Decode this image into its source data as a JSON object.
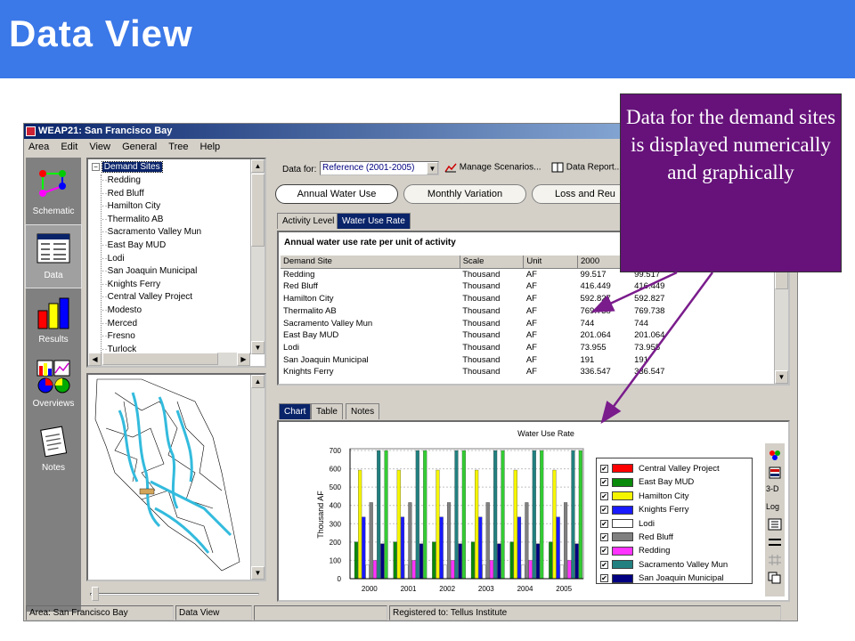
{
  "slide": {
    "title": "Data View",
    "callout": "Data for the demand sites is displayed numerically and graphically",
    "colors": {
      "banner": "#3b78e8",
      "callout": "#66127a",
      "arrow": "#7a1c8c"
    }
  },
  "window": {
    "title": "WEAP21: San Francisco Bay",
    "menu": [
      "Area",
      "Edit",
      "View",
      "General",
      "Tree",
      "Help"
    ]
  },
  "sidebar": [
    {
      "label": "Schematic",
      "icon": "schematic-icon"
    },
    {
      "label": "Data",
      "icon": "data-icon"
    },
    {
      "label": "Results",
      "icon": "results-icon"
    },
    {
      "label": "Overviews",
      "icon": "overviews-icon"
    },
    {
      "label": "Notes",
      "icon": "notes-icon"
    }
  ],
  "tree": {
    "root": "Demand Sites",
    "items": [
      "Redding",
      "Red Bluff",
      "Hamilton City",
      "Thermalito AB",
      "Sacramento Valley Mun",
      "East Bay MUD",
      "Lodi",
      "San Joaquin Municipal",
      "Knights Ferry",
      "Central Valley Project",
      "Modesto",
      "Merced",
      "Fresno",
      "Turlock"
    ]
  },
  "toolbar": {
    "data_for_label": "Data for:",
    "data_for_value": "Reference (2001-2005)",
    "manage_scenarios": "Manage Scenarios...",
    "data_report": "Data Report..."
  },
  "view_tabs": [
    "Annual Water Use",
    "Monthly Variation",
    "Loss and Reu"
  ],
  "sub_tabs": [
    "Activity Level",
    "Water Use Rate"
  ],
  "grid": {
    "caption": "Annual water use rate per unit of activity",
    "columns": [
      "Demand Site",
      "Scale",
      "Unit",
      "2000",
      "2001-2005"
    ],
    "rows": [
      [
        "Redding",
        "Thousand",
        "AF",
        "99.517",
        "99.517"
      ],
      [
        "Red Bluff",
        "Thousand",
        "AF",
        "416.449",
        "416.449"
      ],
      [
        "Hamilton City",
        "Thousand",
        "AF",
        "592.827",
        "592.827"
      ],
      [
        "Thermalito AB",
        "Thousand",
        "AF",
        "769.738",
        "769.738"
      ],
      [
        "Sacramento Valley Mun",
        "Thousand",
        "AF",
        "744",
        "744"
      ],
      [
        "East Bay MUD",
        "Thousand",
        "AF",
        "201.064",
        "201.064"
      ],
      [
        "Lodi",
        "Thousand",
        "AF",
        "73.955",
        "73.955"
      ],
      [
        "San Joaquin Municipal",
        "Thousand",
        "AF",
        "191",
        "191"
      ],
      [
        "Knights Ferry",
        "Thousand",
        "AF",
        "336.547",
        "336.547"
      ]
    ]
  },
  "bottom_tabs": [
    "Chart",
    "Table",
    "Notes"
  ],
  "chart_tools": {
    "three_d": "3-D",
    "log": "Log"
  },
  "chart_data": {
    "type": "bar",
    "title": "Water Use Rate",
    "ylabel": "Thousand AF",
    "xlabel": "",
    "ylim": [
      0,
      700
    ],
    "yticks": [
      0,
      100,
      200,
      300,
      400,
      500,
      600,
      700
    ],
    "categories": [
      "2000",
      "2001",
      "2002",
      "2003",
      "2004",
      "2005"
    ],
    "series": [
      {
        "name": "Central Valley Project",
        "color": "#ff0000",
        "values": [
          0,
          0,
          0,
          0,
          0,
          0
        ]
      },
      {
        "name": "East Bay MUD",
        "color": "#0a8a0a",
        "values": [
          201,
          201,
          201,
          201,
          201,
          201
        ]
      },
      {
        "name": "Hamilton City",
        "color": "#f5f500",
        "values": [
          593,
          593,
          593,
          593,
          593,
          593
        ]
      },
      {
        "name": "Knights Ferry",
        "color": "#1a1aff",
        "values": [
          337,
          337,
          337,
          337,
          337,
          337
        ]
      },
      {
        "name": "Lodi",
        "color": "#ffffff",
        "values": [
          74,
          74,
          74,
          74,
          74,
          74
        ]
      },
      {
        "name": "Red Bluff",
        "color": "#808080",
        "values": [
          416,
          416,
          416,
          416,
          416,
          416
        ]
      },
      {
        "name": "Redding",
        "color": "#ff33ff",
        "values": [
          100,
          100,
          100,
          100,
          100,
          100
        ]
      },
      {
        "name": "Sacramento Valley Mun",
        "color": "#228080",
        "values": [
          744,
          744,
          744,
          744,
          744,
          744
        ]
      },
      {
        "name": "San Joaquin Municipal",
        "color": "#000080",
        "values": [
          191,
          191,
          191,
          191,
          191,
          191
        ]
      },
      {
        "name": "",
        "color": "#33cc33",
        "values": [
          770,
          770,
          770,
          770,
          770,
          770
        ]
      }
    ],
    "grid": true,
    "legend": "right"
  },
  "status": [
    "Area: San Francisco Bay",
    "Data View",
    "",
    "Registered to: Tellus Institute"
  ]
}
